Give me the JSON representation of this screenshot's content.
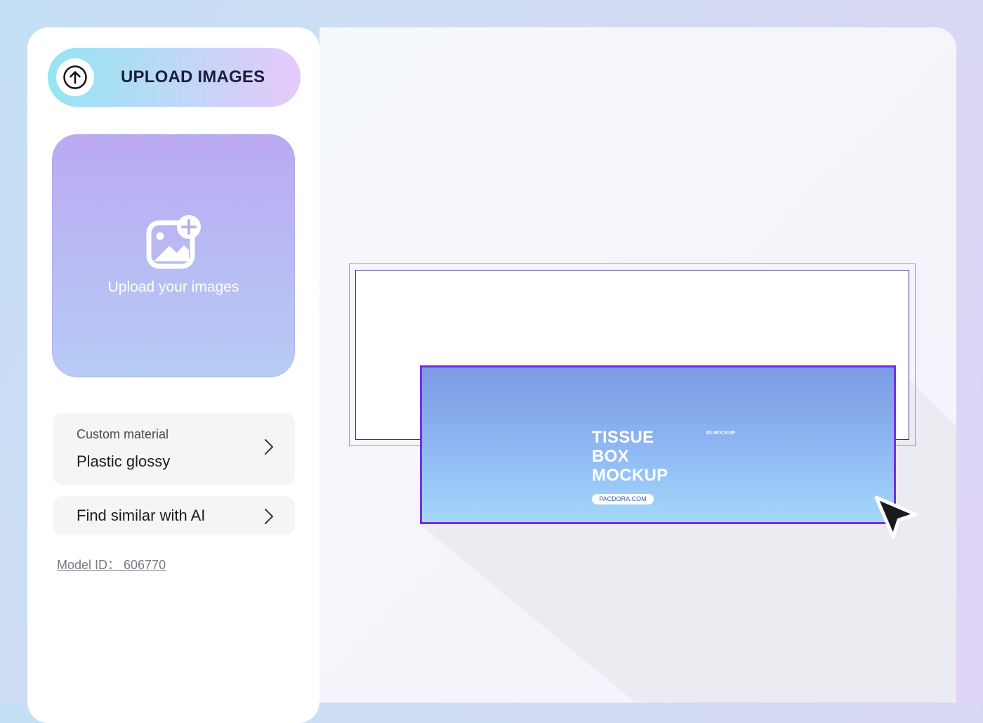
{
  "sidebar": {
    "upload_button": {
      "label": "UPLOAD IMAGES",
      "icon": "upload-arrow-icon"
    },
    "dropzone": {
      "label": "Upload your images",
      "icon": "add-image-icon"
    },
    "material_card": {
      "caption": "Custom material",
      "value": "Plastic glossy",
      "icon": "chevron-right-icon"
    },
    "similar_card": {
      "label": "Find similar with AI",
      "icon": "chevron-right-icon"
    },
    "model_id": "Model ID： 606770"
  },
  "canvas": {
    "mockup": {
      "title_lines": [
        "TISSUE",
        "BOX",
        "MOCKUP"
      ],
      "tag": "3D MOCKUP",
      "url": "PACDORA.COM"
    },
    "cursor_icon": "mouse-pointer-icon"
  },
  "colors": {
    "accent_purple": "#7230e6",
    "outline_green": "#6cc36a",
    "outline_navy": "#3a2f8c"
  }
}
